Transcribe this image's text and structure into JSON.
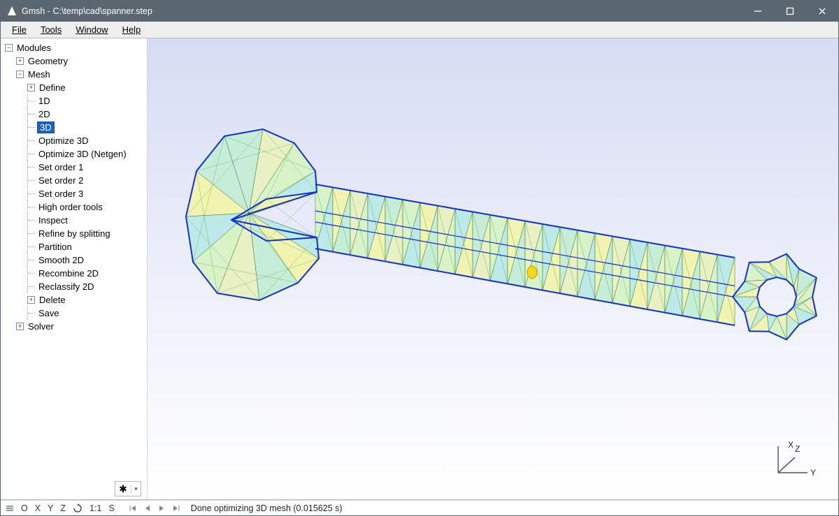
{
  "window": {
    "title": "Gmsh - C:\\temp\\cad\\spanner.step"
  },
  "menu": {
    "file": "File",
    "tools": "Tools",
    "window": "Window",
    "help": "Help"
  },
  "tree": {
    "root": "Modules",
    "geometry": "Geometry",
    "mesh": "Mesh",
    "mesh_items": {
      "define": "Define",
      "oneD": "1D",
      "twoD": "2D",
      "threeD": "3D",
      "optimize3d": "Optimize 3D",
      "optimize3d_netgen": "Optimize 3D (Netgen)",
      "set_order_1": "Set order 1",
      "set_order_2": "Set order 2",
      "set_order_3": "Set order 3",
      "high_order_tools": "High order tools",
      "inspect": "Inspect",
      "refine_by_splitting": "Refine by splitting",
      "partition": "Partition",
      "smooth2d": "Smooth 2D",
      "recombine2d": "Recombine 2D",
      "reclassify2d": "Reclassify 2D",
      "delete": "Delete",
      "save": "Save"
    },
    "solver": "Solver"
  },
  "axes": {
    "x_label": "X",
    "y_label": "Y",
    "z_label": "Z"
  },
  "status": {
    "o": "O",
    "x": "X",
    "y": "Y",
    "z": "Z",
    "one_to_one": "1:1",
    "s": "S",
    "message": "Done optimizing 3D mesh (0.015625 s)"
  }
}
